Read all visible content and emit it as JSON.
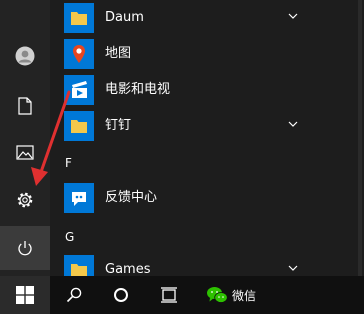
{
  "rail": {
    "items": [
      {
        "name": "user-avatar",
        "icon": "avatar-icon"
      },
      {
        "name": "documents",
        "icon": "document-icon"
      },
      {
        "name": "pictures",
        "icon": "pictures-icon"
      },
      {
        "name": "settings",
        "icon": "gear-icon"
      },
      {
        "name": "power",
        "icon": "power-icon"
      }
    ]
  },
  "apps": [
    {
      "label": "Daum",
      "icon": "folder-icon",
      "expandable": true
    },
    {
      "label": "地图",
      "icon": "maps-icon",
      "expandable": false
    },
    {
      "label": "电影和电视",
      "icon": "movies-tv-icon",
      "expandable": false
    },
    {
      "label": "钉钉",
      "icon": "folder-icon",
      "expandable": true
    },
    {
      "label": "反馈中心",
      "icon": "feedback-hub-icon",
      "expandable": false
    },
    {
      "label": "Games",
      "icon": "folder-icon",
      "expandable": true
    }
  ],
  "section_letters": [
    "F",
    "G"
  ],
  "taskbar": {
    "items": [
      {
        "name": "start-button",
        "icon": "windows-logo-icon"
      },
      {
        "name": "search-button",
        "icon": "search-icon"
      },
      {
        "name": "cortana-button",
        "icon": "cortana-ring-icon"
      },
      {
        "name": "task-view-button",
        "icon": "task-view-icon"
      },
      {
        "name": "wechat-button",
        "icon": "wechat-icon"
      }
    ],
    "wechat_label": "微信"
  },
  "colors": {
    "accent_blue": "#0078d7",
    "folder_yellow": "#f3c84b",
    "annotation_red": "#e03030",
    "wechat_green": "#2dc100"
  }
}
